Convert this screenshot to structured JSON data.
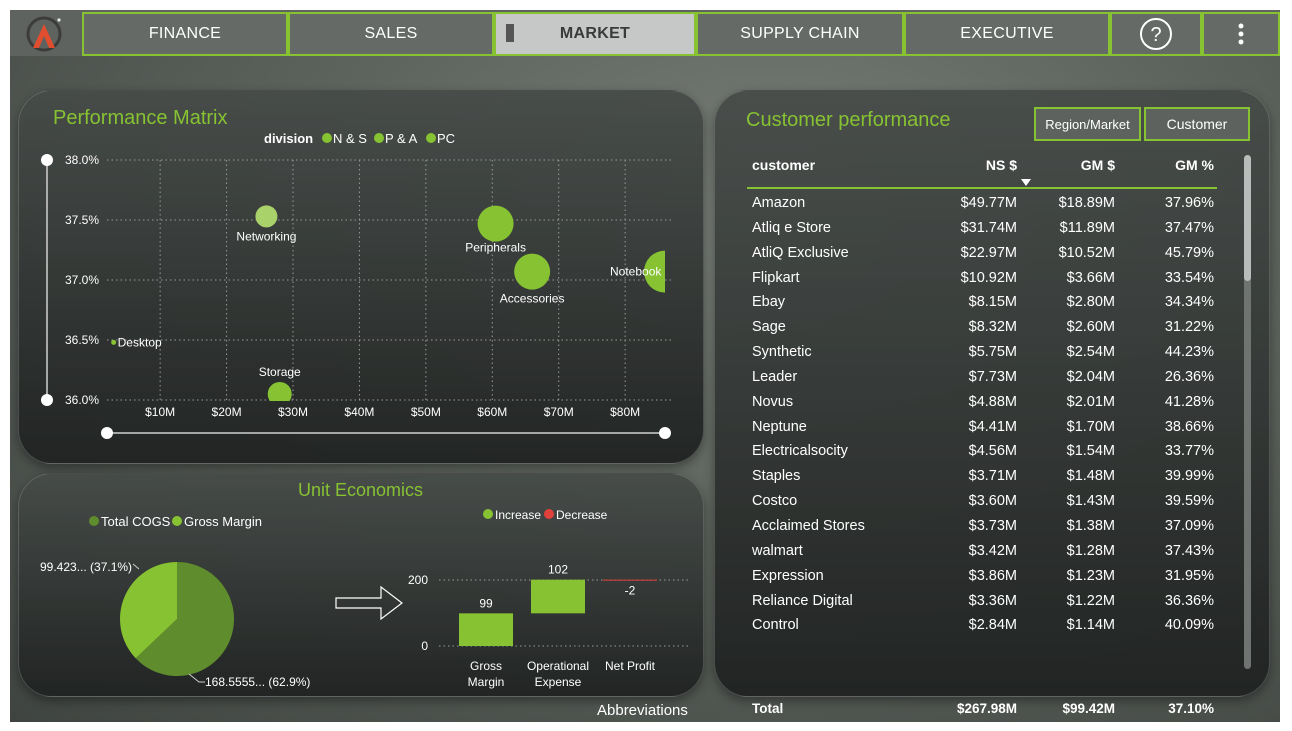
{
  "nav": {
    "tabs": [
      {
        "label": "FINANCE",
        "active": false
      },
      {
        "label": "SALES",
        "active": false
      },
      {
        "label": "MARKET",
        "active": true
      },
      {
        "label": "SUPPLY CHAIN",
        "active": false
      },
      {
        "label": "EXECUTIVE",
        "active": false
      }
    ],
    "help_icon": "question-circle-icon",
    "more_icon": "vertical-ellipsis-icon"
  },
  "colors": {
    "accent": "#86c232",
    "dark_green": "#5f8c2c",
    "decrease": "#e0413a"
  },
  "performance_matrix": {
    "title": "Performance Matrix",
    "legend_title": "division",
    "legend": [
      "N & S",
      "P & A",
      "PC"
    ]
  },
  "unit_economics": {
    "title": "Unit Economics",
    "pie_legend": [
      "Total COGS",
      "Gross Margin"
    ],
    "waterfall_legend": [
      "Increase",
      "Decrease"
    ]
  },
  "customer_performance": {
    "title": "Customer performance",
    "buttons": [
      "Region/Market",
      "Customer"
    ],
    "columns": [
      "customer",
      "NS $",
      "GM $",
      "GM %"
    ],
    "rows": [
      [
        "Amazon",
        "$49.77M",
        "$18.89M",
        "37.96%"
      ],
      [
        "Atliq e Store",
        "$31.74M",
        "$11.89M",
        "37.47%"
      ],
      [
        "AtliQ Exclusive",
        "$22.97M",
        "$10.52M",
        "45.79%"
      ],
      [
        "Flipkart",
        "$10.92M",
        "$3.66M",
        "33.54%"
      ],
      [
        "Ebay",
        "$8.15M",
        "$2.80M",
        "34.34%"
      ],
      [
        "Sage",
        "$8.32M",
        "$2.60M",
        "31.22%"
      ],
      [
        "Synthetic",
        "$5.75M",
        "$2.54M",
        "44.23%"
      ],
      [
        "Leader",
        "$7.73M",
        "$2.04M",
        "26.36%"
      ],
      [
        "Novus",
        "$4.88M",
        "$2.01M",
        "41.28%"
      ],
      [
        "Neptune",
        "$4.41M",
        "$1.70M",
        "38.66%"
      ],
      [
        "Electricalsocity",
        "$4.56M",
        "$1.54M",
        "33.77%"
      ],
      [
        "Staples",
        "$3.71M",
        "$1.48M",
        "39.99%"
      ],
      [
        "Costco",
        "$3.60M",
        "$1.43M",
        "39.59%"
      ],
      [
        "Acclaimed Stores",
        "$3.73M",
        "$1.38M",
        "37.09%"
      ],
      [
        "walmart",
        "$3.42M",
        "$1.28M",
        "37.43%"
      ],
      [
        "Expression",
        "$3.86M",
        "$1.23M",
        "31.95%"
      ],
      [
        "Reliance Digital",
        "$3.36M",
        "$1.22M",
        "36.36%"
      ],
      [
        "Control",
        "$2.84M",
        "$1.14M",
        "40.09%"
      ]
    ],
    "total": [
      "Total",
      "$267.98M",
      "$99.42M",
      "37.10%"
    ]
  },
  "footer": {
    "abbreviations_label": "Abbreviations"
  },
  "chart_data": [
    {
      "type": "scatter",
      "title": "Performance Matrix",
      "xlabel": "",
      "ylabel": "",
      "xlim": [
        2,
        86
      ],
      "ylim": [
        36.0,
        38.0
      ],
      "x_ticks": [
        "$10M",
        "$20M",
        "$30M",
        "$40M",
        "$50M",
        "$60M",
        "$70M",
        "$80M"
      ],
      "y_ticks": [
        "38.0%",
        "37.5%",
        "37.0%",
        "36.5%",
        "36.0%"
      ],
      "legend_title": "division",
      "legend": [
        "N & S",
        "P & A",
        "PC"
      ],
      "points": [
        {
          "label": "Networking",
          "x": 26,
          "y": 37.53,
          "size": 11,
          "color": "#a9d26b"
        },
        {
          "label": "Peripherals",
          "x": 60.5,
          "y": 37.47,
          "size": 18,
          "color": "#86c232"
        },
        {
          "label": "Accessories",
          "x": 66,
          "y": 37.07,
          "size": 18,
          "color": "#86c232"
        },
        {
          "label": "Notebook",
          "x": 86,
          "y": 37.07,
          "size": 21,
          "color": "#86c232"
        },
        {
          "label": "Desktop",
          "x": 3,
          "y": 36.48,
          "size": 2.5,
          "color": "#86c232"
        },
        {
          "label": "Storage",
          "x": 28,
          "y": 36.05,
          "size": 12,
          "color": "#86c232"
        }
      ]
    },
    {
      "type": "pie",
      "title": "",
      "legend": [
        "Total COGS",
        "Gross Margin"
      ],
      "slices": [
        {
          "name": "Total COGS",
          "value": 168.5555,
          "percent": 62.9,
          "label": "168.5555... (62.9%)",
          "color": "#5f8c2c"
        },
        {
          "name": "Gross Margin",
          "value": 99.423,
          "percent": 37.1,
          "label": "99.423... (37.1%)",
          "color": "#86c232"
        }
      ]
    },
    {
      "type": "bar",
      "subtype": "waterfall",
      "title": "",
      "legend": [
        "Increase",
        "Decrease"
      ],
      "categories": [
        "Gross Margin",
        "Operational Expense",
        "Net Profit"
      ],
      "category_labels": [
        [
          "Gross",
          "Margin"
        ],
        [
          "Operational",
          "Expense"
        ],
        [
          "Net Profit"
        ]
      ],
      "values": [
        99,
        102,
        -2
      ],
      "value_labels": [
        "99",
        "102",
        "-2"
      ],
      "y_ticks": [
        0,
        200
      ],
      "ylim": [
        0,
        220
      ]
    }
  ]
}
